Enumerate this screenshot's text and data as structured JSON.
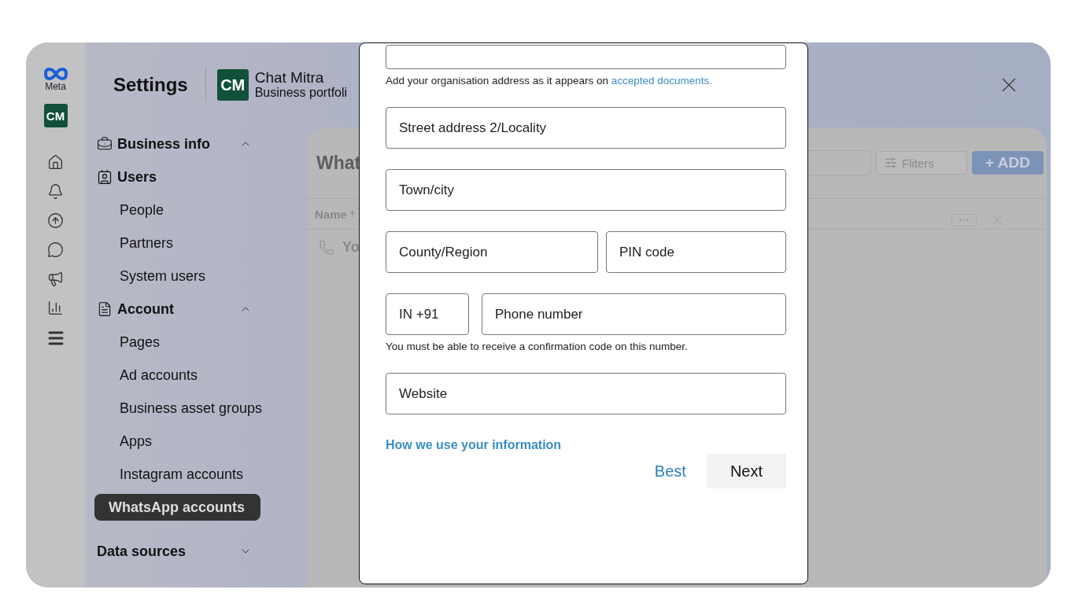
{
  "rail": {
    "logo_text": "Meta",
    "brand_logo": "CM"
  },
  "header": {
    "title": "Settings",
    "brand_logo": "CM",
    "brand_name": "Chat Mitra",
    "brand_subtitle": "Business portfoli"
  },
  "sidebar": {
    "sections": [
      {
        "label": "Business info",
        "expanded": true,
        "children": [
          {
            "label": "Users",
            "kind": "heading",
            "selected": false
          },
          {
            "label": "People",
            "kind": "item",
            "selected": false
          },
          {
            "label": "Partners",
            "kind": "item",
            "selected": false
          },
          {
            "label": "System users",
            "kind": "item",
            "selected": false
          }
        ]
      },
      {
        "label": "Account",
        "expanded": true,
        "children": [
          {
            "label": "Pages",
            "kind": "item",
            "selected": false
          },
          {
            "label": "Ad accounts",
            "kind": "item",
            "selected": false
          },
          {
            "label": "Business asset groups",
            "kind": "item",
            "selected": false
          },
          {
            "label": "Apps",
            "kind": "item",
            "selected": false
          },
          {
            "label": "Instagram accounts",
            "kind": "item",
            "selected": false
          },
          {
            "label": "WhatsApp accounts",
            "kind": "item",
            "selected": true
          }
        ]
      },
      {
        "label": "Data sources",
        "expanded": false
      }
    ]
  },
  "content": {
    "title": "What",
    "filters_label": "Fliters",
    "add_label": "+ ADD",
    "table": {
      "columns": [
        "Name"
      ],
      "rows": [
        {
          "cells": [
            "Yo"
          ]
        }
      ]
    }
  },
  "modal": {
    "blocks": [
      {
        "kind": "cut_field"
      },
      {
        "kind": "note",
        "text": "Add your organisation address as it appears on ",
        "link": "accepted documents."
      },
      {
        "kind": "fields",
        "fields": [
          {
            "placeholder": "Street address 2/Locality"
          }
        ]
      },
      {
        "kind": "fields",
        "fields": [
          {
            "placeholder": "Town/city"
          }
        ]
      },
      {
        "kind": "fields",
        "fields": [
          {
            "placeholder": "County/Region"
          },
          {
            "placeholder": "PIN code"
          }
        ]
      },
      {
        "kind": "phone",
        "fields": [
          {
            "value": "IN +91"
          },
          {
            "placeholder": "Phone number"
          }
        ]
      },
      {
        "kind": "note",
        "text": "You must be able to receive a confirmation code on this number."
      },
      {
        "kind": "fields",
        "fields": [
          {
            "placeholder": "Website"
          }
        ]
      }
    ],
    "info_link": "How we use your information",
    "buttons": [
      {
        "label": "Best",
        "kind": "link"
      },
      {
        "label": "Next",
        "kind": "primary"
      }
    ]
  }
}
